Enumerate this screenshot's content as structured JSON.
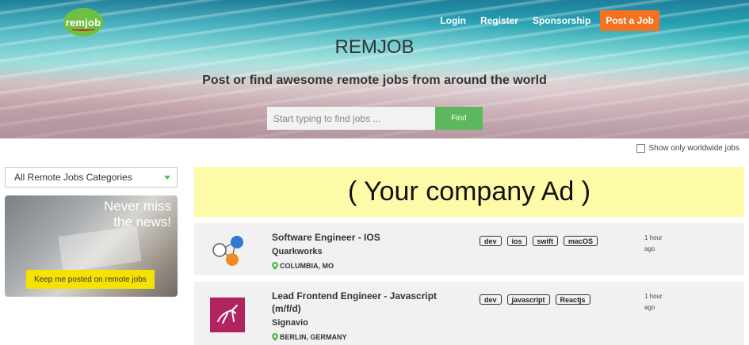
{
  "brand": {
    "logo_text": "remjob"
  },
  "nav": {
    "login": "Login",
    "register": "Register",
    "sponsorship": "Sponsorship",
    "post_job": "Post a Job"
  },
  "hero": {
    "title": "REMJOB",
    "subtitle": "Post or find awesome remote jobs from around the world",
    "search_placeholder": "Start typing to find jobs ...",
    "find_label": "Find"
  },
  "filters": {
    "worldwide_label": "Show only worldwide jobs"
  },
  "sidebar": {
    "category_select": "All Remote Jobs Categories",
    "newsletter": {
      "title_line1": "Never miss",
      "title_line2": "the news!",
      "button": "Keep me posted on remote jobs"
    }
  },
  "ad": {
    "text": "( Your company Ad )"
  },
  "jobs": [
    {
      "title": "Software Engineer - IOS",
      "company": "Quarkworks",
      "location": "COLUMBIA, MO",
      "tags": [
        "dev",
        "ios",
        "swift",
        "macOS"
      ],
      "time_line1": "1 hour",
      "time_line2": "ago"
    },
    {
      "title": "Lead Frontend Engineer - Javascript (m/f/d)",
      "company": "Signavio",
      "location": "BERLIN, GERMANY",
      "tags": [
        "dev",
        "javascript",
        "Reactjs"
      ],
      "time_line1": "1 hour",
      "time_line2": "ago"
    }
  ],
  "colors": {
    "accent_orange": "#f4711f",
    "find_green": "#5cb85c",
    "newsletter_yellow": "#f5e200",
    "ad_yellow": "#fdfaa8",
    "signavio_magenta": "#b0245f"
  }
}
